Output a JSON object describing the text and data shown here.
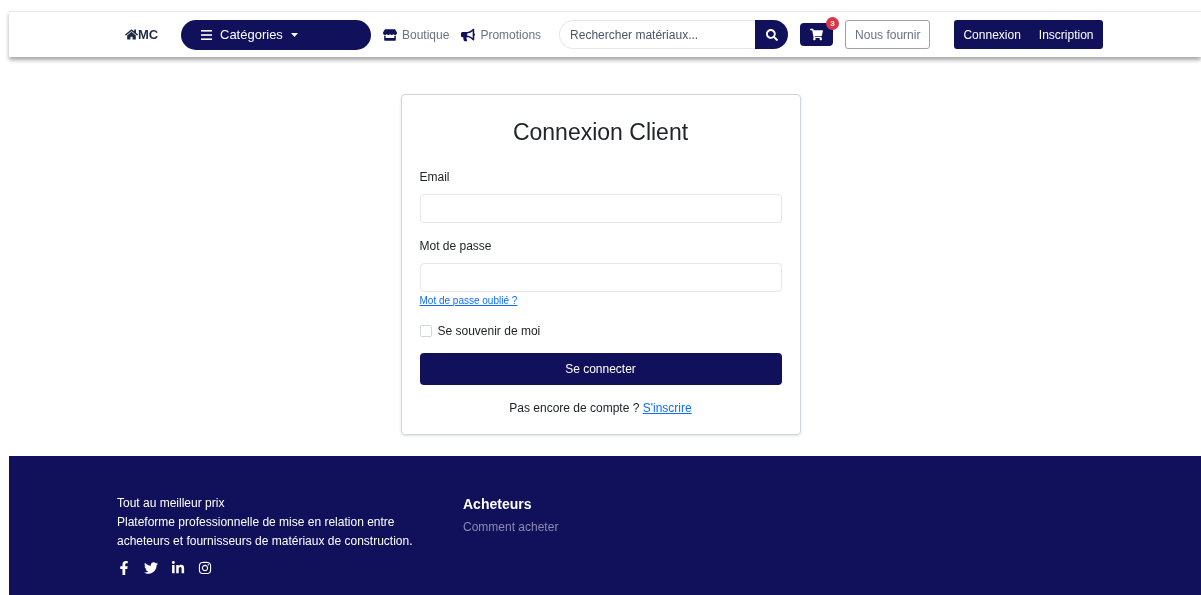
{
  "header": {
    "logo": "MC",
    "categories_button": "Catégories",
    "nav_links": [
      {
        "kind": "store",
        "label": "Boutique"
      },
      {
        "kind": "megaphone",
        "label": "Promotions"
      }
    ],
    "search": {
      "placeholder": "Rechercher matériaux..."
    },
    "cart": {
      "count": "3"
    },
    "supplier_button": "Nous fournir",
    "auth_links": [
      "Connexion",
      "Inscription"
    ]
  },
  "login": {
    "title": "Connexion Client",
    "fields": [
      {
        "label": "Email"
      },
      {
        "label": "Mot de passe"
      }
    ],
    "forgot_link": "Mot de passe oublié ?",
    "remember": {
      "label": "Se souvenir de moi",
      "checked": false
    },
    "submit": "Se connecter",
    "signup_prompt": "Pas encore de compte ?",
    "signup_link": "S'inscrire"
  },
  "footer": {
    "tagline": "Tout au meilleur prix",
    "description": "Plateforme professionnelle de mise en relation entre acheteurs et fournisseurs de matériaux de construction.",
    "columns": [
      {
        "title": "Acheteurs",
        "links": [
          "Comment acheter"
        ]
      }
    ]
  }
}
